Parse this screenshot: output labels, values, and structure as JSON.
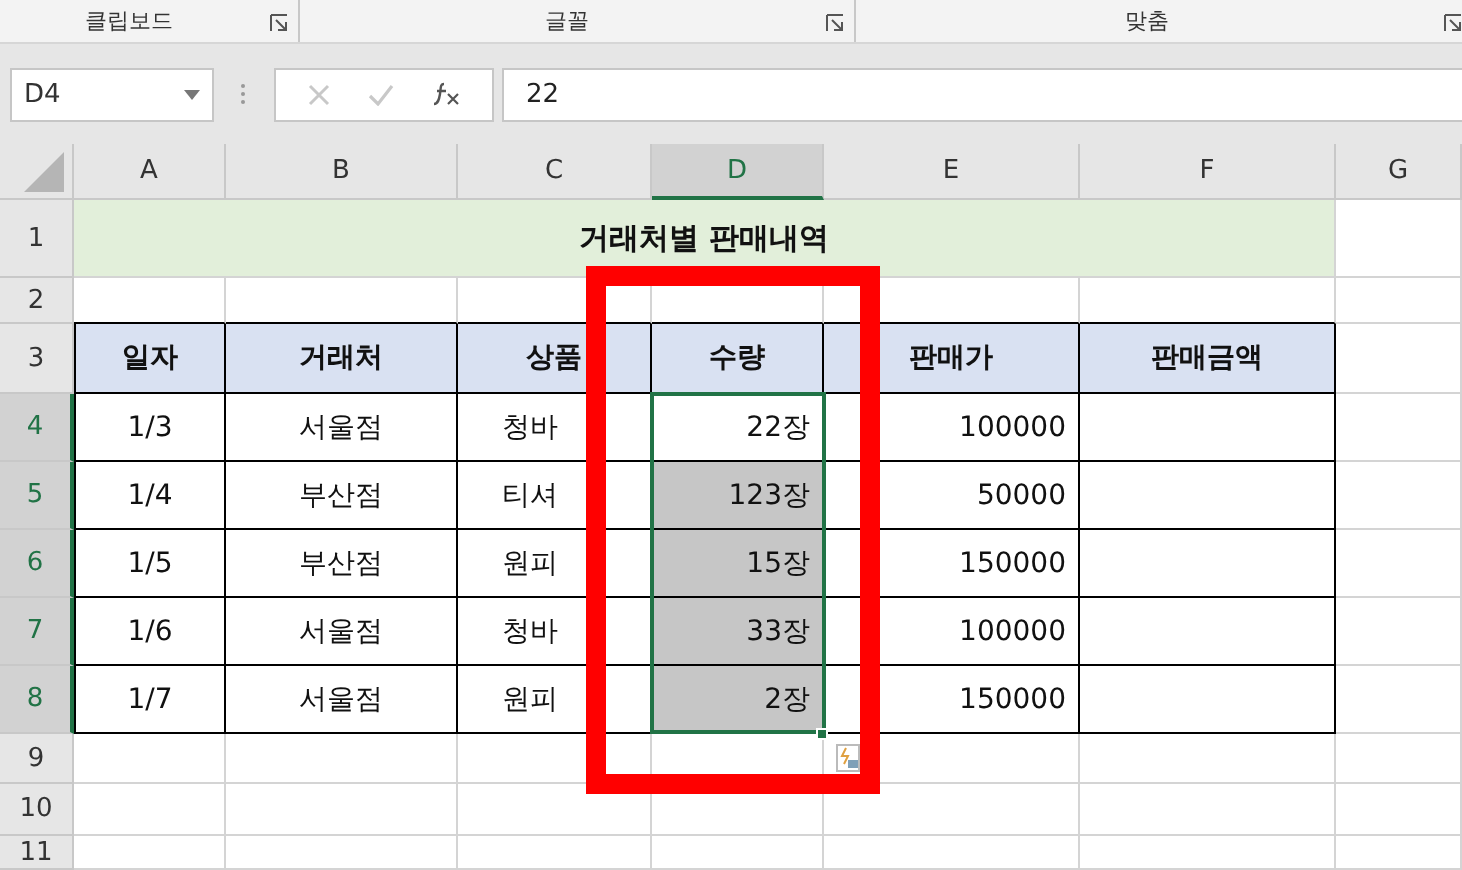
{
  "ribbon_groups": [
    {
      "label": "클립보드"
    },
    {
      "label": "글꼴"
    },
    {
      "label": "맞춤"
    }
  ],
  "name_box": "D4",
  "formula": "22",
  "columns": [
    {
      "label": "A",
      "selected": false
    },
    {
      "label": "B",
      "selected": false
    },
    {
      "label": "C",
      "selected": false
    },
    {
      "label": "D",
      "selected": true
    },
    {
      "label": "E",
      "selected": false
    },
    {
      "label": "F",
      "selected": false
    },
    {
      "label": "G",
      "selected": false
    }
  ],
  "row_headers": [
    {
      "label": "1",
      "selected": false
    },
    {
      "label": "2",
      "selected": false
    },
    {
      "label": "3",
      "selected": false
    },
    {
      "label": "4",
      "selected": true
    },
    {
      "label": "5",
      "selected": true
    },
    {
      "label": "6",
      "selected": true
    },
    {
      "label": "7",
      "selected": true
    },
    {
      "label": "8",
      "selected": true
    },
    {
      "label": "9",
      "selected": false
    },
    {
      "label": "10",
      "selected": false
    },
    {
      "label": "11",
      "selected": false
    }
  ],
  "title": "거래처별 판매내역",
  "headers": [
    "일자",
    "거래처",
    "상품",
    "수량",
    "판매가",
    "판매금액"
  ],
  "sales": [
    {
      "date": "1/3",
      "store": "서울점",
      "product": "청바",
      "qty": "22장",
      "qty_selected": false,
      "price": "100000"
    },
    {
      "date": "1/4",
      "store": "부산점",
      "product": "티셔",
      "qty": "123장",
      "qty_selected": true,
      "price": "50000"
    },
    {
      "date": "1/5",
      "store": "부산점",
      "product": "원피",
      "qty": "15장",
      "qty_selected": true,
      "price": "150000"
    },
    {
      "date": "1/6",
      "store": "서울점",
      "product": "청바",
      "qty": "33장",
      "qty_selected": true,
      "price": "100000"
    },
    {
      "date": "1/7",
      "store": "서울점",
      "product": "원피",
      "qty": "2장",
      "qty_selected": true,
      "price": "150000"
    }
  ]
}
